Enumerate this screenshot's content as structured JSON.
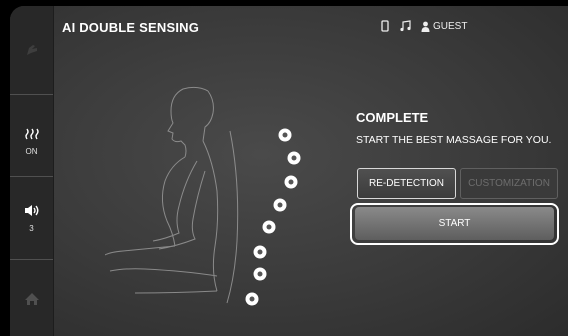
{
  "header": {
    "title": "AI DOUBLE SENSING",
    "status_icons": [
      "phone-icon",
      "music-note-icon",
      "user-icon"
    ],
    "user_label": "GUEST"
  },
  "sidebar": {
    "items": [
      {
        "icon": "chair-icon"
      },
      {
        "icon": "heat-icon",
        "label": "ON"
      },
      {
        "icon": "volume-icon",
        "label": "3"
      },
      {
        "icon": "home-icon"
      }
    ]
  },
  "main": {
    "status_title": "COMPLETE",
    "message": "START THE BEST MASSAGE FOR YOU.",
    "redetection_label": "RE-DETECTION",
    "customization_label": "CUSTOMIZATION",
    "start_label": "START",
    "sensing_points": 8
  },
  "colors": {
    "background": "#3a3a3a",
    "sidebar": "#282828",
    "start_button": "#777777",
    "disabled_text": "#6d6d6d"
  }
}
